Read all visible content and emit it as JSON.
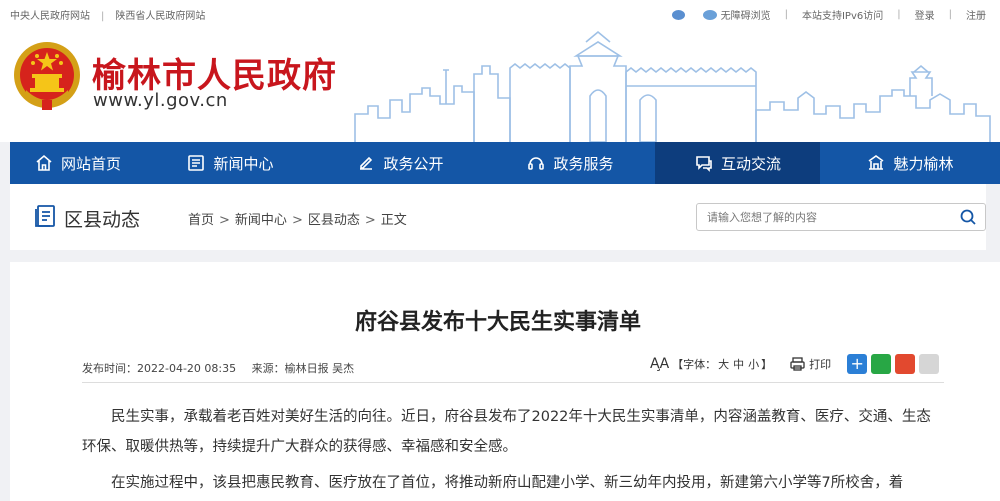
{
  "topbar": {
    "links": [
      "中央人民政府网站",
      "陕西省人民政府网站"
    ],
    "accessible": "无障碍浏览",
    "ipv6": "本站支持IPv6访问",
    "login": "登录",
    "register": "注册"
  },
  "header": {
    "title": "榆林市人民政府",
    "url": "www.yl.gov.cn"
  },
  "nav": [
    {
      "label": "网站首页",
      "icon": "home-icon"
    },
    {
      "label": "新闻中心",
      "icon": "newspaper-icon"
    },
    {
      "label": "政务公开",
      "icon": "edit-icon"
    },
    {
      "label": "政务服务",
      "icon": "service-icon"
    },
    {
      "label": "互动交流",
      "icon": "chat-icon"
    },
    {
      "label": "魅力榆林",
      "icon": "landmark-icon"
    }
  ],
  "section": {
    "title": "区县动态",
    "breadcrumb": [
      "首页",
      "新闻中心",
      "区县动态",
      "正文"
    ],
    "search_placeholder": "请输入您想了解的内容"
  },
  "article": {
    "title": "府谷县发布十大民生实事清单",
    "publish_time": "发布时间：2022-04-20 08:35",
    "source": "来源：榆林日报 吴杰",
    "font_label": "【字体：",
    "font_sizes": [
      "大",
      "中",
      "小"
    ],
    "font_close": "】",
    "print": "打印",
    "paragraphs": [
      "民生实事，承载着老百姓对美好生活的向往。近日，府谷县发布了2022年十大民生实事清单，内容涵盖教育、医疗、交通、生态环保、取暖供热等，持续提升广大群众的获得感、幸福感和安全感。",
      "在实施过程中，该县把惠民教育、医疗放在了首位，将推动新府山配建小学、新三幼年内投用，新建第六小学等7所校舍，着"
    ]
  },
  "colors": {
    "brand_red": "#c8161d",
    "nav_blue": "#1456a6",
    "nav_active": "#0d3d7d"
  }
}
